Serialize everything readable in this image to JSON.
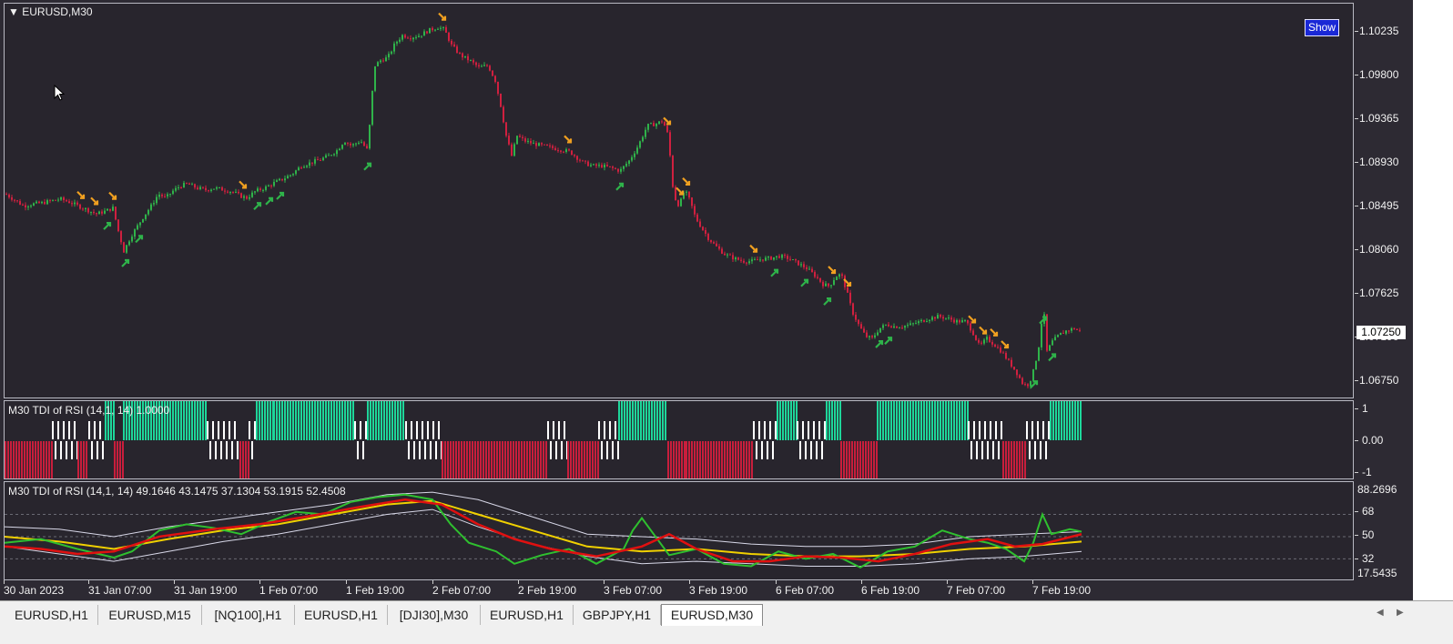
{
  "main_chart": {
    "symbol_label": "EURUSD,M30",
    "show_button": "Show",
    "price_scale": [
      "1.10235",
      "1.09800",
      "1.09365",
      "1.08930",
      "1.08495",
      "1.08060",
      "1.07625",
      "1.07190",
      "1.06750"
    ],
    "current_price": "1.07250"
  },
  "histogram_indicator": {
    "label": "M30  TDI of RSI  (14,1, 14) 1.0000",
    "scale": [
      "1",
      "0.00",
      "-1"
    ]
  },
  "tdi_indicator": {
    "label": "M30  TDI of RSI  (14,1, 14) 49.1646 43.1475 37.1304 53.1915 52.4508",
    "scale": [
      "88.2696",
      "68",
      "50",
      "32",
      "17.5435"
    ]
  },
  "time_axis": [
    "30 Jan 2023",
    "31 Jan 07:00",
    "31 Jan 19:00",
    "1 Feb 07:00",
    "1 Feb 19:00",
    "2 Feb 07:00",
    "2 Feb 19:00",
    "3 Feb 07:00",
    "3 Feb 19:00",
    "6 Feb 07:00",
    "6 Feb 19:00",
    "7 Feb 07:00",
    "7 Feb 19:00"
  ],
  "tabs": [
    "EURUSD,H1",
    "EURUSD,M15",
    "[NQ100],H1",
    "EURUSD,H1",
    "[DJI30],M30",
    "EURUSD,H1",
    "GBPJPY,H1",
    "EURUSD,M30"
  ],
  "active_tab": 7,
  "colors": {
    "background": "#28252d",
    "bull_candle": "#2fb34a",
    "bear_candle": "#d0203f",
    "buy_arrow": "#2fb34a",
    "sell_arrow": "#f0a020",
    "hist_up": "#1ed69a",
    "hist_down": "#c81e3c",
    "hist_neutral": "#ffffff",
    "rsi_line": "#2fc02f",
    "signal_line": "#e01010",
    "market_base": "#f0d000",
    "bands": "#d8d8e8"
  },
  "chart_data": {
    "type": "candlestick",
    "timeframe": "M30",
    "close_path": [
      [
        0,
        1.0862
      ],
      [
        10,
        1.0856
      ],
      [
        20,
        1.085
      ],
      [
        30,
        1.0852
      ],
      [
        40,
        1.0853
      ],
      [
        50,
        1.0855
      ],
      [
        60,
        1.0857
      ],
      [
        70,
        1.0854
      ],
      [
        80,
        1.085
      ],
      [
        90,
        1.0846
      ],
      [
        100,
        1.0842
      ],
      [
        110,
        1.0845
      ],
      [
        118,
        1.0848
      ],
      [
        124,
        1.0825
      ],
      [
        130,
        1.0805
      ],
      [
        138,
        1.082
      ],
      [
        145,
        1.083
      ],
      [
        152,
        1.084
      ],
      [
        160,
        1.085
      ],
      [
        168,
        1.0862
      ],
      [
        176,
        1.0858
      ],
      [
        184,
        1.0865
      ],
      [
        192,
        1.087
      ],
      [
        200,
        1.0872
      ],
      [
        210,
        1.0868
      ],
      [
        220,
        1.0866
      ],
      [
        230,
        1.0868
      ],
      [
        240,
        1.0866
      ],
      [
        250,
        1.0864
      ],
      [
        258,
        1.086
      ],
      [
        265,
        1.0858
      ],
      [
        275,
        1.0865
      ],
      [
        285,
        1.0868
      ],
      [
        295,
        1.0873
      ],
      [
        305,
        1.0877
      ],
      [
        315,
        1.0882
      ],
      [
        325,
        1.089
      ],
      [
        335,
        1.0893
      ],
      [
        345,
        1.0896
      ],
      [
        355,
        1.09
      ],
      [
        365,
        1.0906
      ],
      [
        372,
        1.0915
      ],
      [
        380,
        1.091
      ],
      [
        390,
        1.0915
      ],
      [
        398,
        1.0905
      ],
      [
        402,
        1.0955
      ],
      [
        406,
        1.099
      ],
      [
        412,
        1.0995
      ],
      [
        420,
        1.0998
      ],
      [
        428,
        1.1012
      ],
      [
        436,
        1.102
      ],
      [
        445,
        1.1018
      ],
      [
        455,
        1.102
      ],
      [
        465,
        1.1025
      ],
      [
        475,
        1.1028
      ],
      [
        482,
        1.1026
      ],
      [
        490,
        1.101
      ],
      [
        500,
        1.1
      ],
      [
        510,
        1.0995
      ],
      [
        520,
        1.0988
      ],
      [
        530,
        1.099
      ],
      [
        538,
        1.0975
      ],
      [
        544,
        1.095
      ],
      [
        550,
        1.092
      ],
      [
        556,
        1.09
      ],
      [
        562,
        1.092
      ],
      [
        570,
        1.0915
      ],
      [
        580,
        1.0912
      ],
      [
        590,
        1.091
      ],
      [
        600,
        1.0908
      ],
      [
        610,
        1.0906
      ],
      [
        620,
        1.0904
      ],
      [
        628,
        1.0898
      ],
      [
        635,
        1.0893
      ],
      [
        645,
        1.089
      ],
      [
        655,
        1.089
      ],
      [
        665,
        1.0888
      ],
      [
        675,
        1.0885
      ],
      [
        685,
        1.0895
      ],
      [
        695,
        1.091
      ],
      [
        705,
        1.093
      ],
      [
        715,
        1.0932
      ],
      [
        722,
        1.0935
      ],
      [
        728,
        1.092
      ],
      [
        734,
        1.086
      ],
      [
        740,
        1.085
      ],
      [
        746,
        1.0866
      ],
      [
        752,
        1.0855
      ],
      [
        758,
        1.0838
      ],
      [
        765,
        1.0828
      ],
      [
        772,
        1.0818
      ],
      [
        780,
        1.081
      ],
      [
        790,
        1.0802
      ],
      [
        800,
        1.0798
      ],
      [
        810,
        1.0795
      ],
      [
        820,
        1.0795
      ],
      [
        830,
        1.0797
      ],
      [
        840,
        1.0798
      ],
      [
        850,
        1.08
      ],
      [
        860,
        1.0798
      ],
      [
        870,
        1.0793
      ],
      [
        880,
        1.0788
      ],
      [
        890,
        1.078
      ],
      [
        898,
        1.0772
      ],
      [
        905,
        1.077
      ],
      [
        912,
        1.078
      ],
      [
        918,
        1.0782
      ],
      [
        924,
        1.0765
      ],
      [
        930,
        1.0745
      ],
      [
        938,
        1.073
      ],
      [
        945,
        1.072
      ],
      [
        952,
        1.0718
      ],
      [
        960,
        1.0728
      ],
      [
        968,
        1.0732
      ],
      [
        976,
        1.073
      ],
      [
        985,
        1.073
      ],
      [
        995,
        1.0732
      ],
      [
        1005,
        1.0735
      ],
      [
        1015,
        1.0738
      ],
      [
        1025,
        1.074
      ],
      [
        1035,
        1.0738
      ],
      [
        1045,
        1.0735
      ],
      [
        1055,
        1.0735
      ],
      [
        1062,
        1.0725
      ],
      [
        1070,
        1.071
      ],
      [
        1078,
        1.0718
      ],
      [
        1086,
        1.0712
      ],
      [
        1094,
        1.0705
      ],
      [
        1102,
        1.0695
      ],
      [
        1110,
        1.0685
      ],
      [
        1118,
        1.0672
      ],
      [
        1124,
        1.0672
      ],
      [
        1130,
        1.0688
      ],
      [
        1136,
        1.0715
      ],
      [
        1140,
        1.0752
      ],
      [
        1144,
        1.0705
      ],
      [
        1150,
        1.0715
      ],
      [
        1158,
        1.0722
      ],
      [
        1166,
        1.0726
      ],
      [
        1174,
        1.0728
      ],
      [
        1180,
        1.0725
      ]
    ],
    "sell_arrows_x": [
      83,
      98,
      118,
      261,
      480,
      618,
      727,
      741,
      748,
      822,
      908,
      925,
      1062,
      1074,
      1086,
      1098
    ],
    "buy_arrows_x": [
      112,
      132,
      147,
      277,
      290,
      302,
      398,
      675,
      845,
      878,
      903,
      960,
      970,
      1130,
      1140,
      1150
    ],
    "histogram_segments": [
      {
        "from": 0,
        "to": 52,
        "state": -1
      },
      {
        "from": 52,
        "to": 80,
        "state": 0
      },
      {
        "from": 80,
        "to": 92,
        "state": -1
      },
      {
        "from": 92,
        "to": 110,
        "state": 0
      },
      {
        "from": 110,
        "to": 120,
        "state": 1
      },
      {
        "from": 120,
        "to": 130,
        "state": -1
      },
      {
        "from": 130,
        "to": 222,
        "state": 1
      },
      {
        "from": 222,
        "to": 258,
        "state": 0
      },
      {
        "from": 258,
        "to": 268,
        "state": -1
      },
      {
        "from": 268,
        "to": 276,
        "state": 0
      },
      {
        "from": 276,
        "to": 295,
        "state": 1
      },
      {
        "from": 295,
        "to": 384,
        "state": 1
      },
      {
        "from": 384,
        "to": 398,
        "state": 0
      },
      {
        "from": 398,
        "to": 440,
        "state": 1
      },
      {
        "from": 440,
        "to": 480,
        "state": 0
      },
      {
        "from": 480,
        "to": 596,
        "state": -1
      },
      {
        "from": 596,
        "to": 618,
        "state": 0
      },
      {
        "from": 618,
        "to": 652,
        "state": -1
      },
      {
        "from": 652,
        "to": 674,
        "state": 0
      },
      {
        "from": 674,
        "to": 728,
        "state": 1
      },
      {
        "from": 728,
        "to": 748,
        "state": -1
      },
      {
        "from": 748,
        "to": 822,
        "state": -1
      },
      {
        "from": 822,
        "to": 848,
        "state": 0
      },
      {
        "from": 848,
        "to": 870,
        "state": 1
      },
      {
        "from": 870,
        "to": 902,
        "state": 0
      },
      {
        "from": 902,
        "to": 918,
        "state": 1
      },
      {
        "from": 918,
        "to": 958,
        "state": -1
      },
      {
        "from": 958,
        "to": 1058,
        "state": 1
      },
      {
        "from": 1058,
        "to": 1096,
        "state": 0
      },
      {
        "from": 1096,
        "to": 1122,
        "state": -1
      },
      {
        "from": 1122,
        "to": 1148,
        "state": 0
      },
      {
        "from": 1148,
        "to": 1183,
        "state": 1
      }
    ],
    "tdi": {
      "ylim": [
        17.5435,
        88.2696
      ],
      "rsi": [
        [
          0,
          45
        ],
        [
          40,
          48
        ],
        [
          80,
          40
        ],
        [
          120,
          33
        ],
        [
          140,
          38
        ],
        [
          170,
          55
        ],
        [
          200,
          60
        ],
        [
          230,
          57
        ],
        [
          260,
          52
        ],
        [
          290,
          62
        ],
        [
          320,
          70
        ],
        [
          350,
          68
        ],
        [
          380,
          78
        ],
        [
          410,
          82
        ],
        [
          440,
          84
        ],
        [
          470,
          80
        ],
        [
          490,
          60
        ],
        [
          510,
          45
        ],
        [
          540,
          38
        ],
        [
          560,
          28
        ],
        [
          590,
          35
        ],
        [
          620,
          40
        ],
        [
          650,
          28
        ],
        [
          680,
          40
        ],
        [
          690,
          55
        ],
        [
          700,
          65
        ],
        [
          715,
          50
        ],
        [
          730,
          35
        ],
        [
          760,
          40
        ],
        [
          790,
          28
        ],
        [
          820,
          26
        ],
        [
          850,
          38
        ],
        [
          880,
          32
        ],
        [
          910,
          36
        ],
        [
          940,
          25
        ],
        [
          970,
          38
        ],
        [
          1000,
          42
        ],
        [
          1030,
          55
        ],
        [
          1060,
          48
        ],
        [
          1080,
          45
        ],
        [
          1100,
          40
        ],
        [
          1120,
          30
        ],
        [
          1130,
          45
        ],
        [
          1140,
          68
        ],
        [
          1150,
          52
        ],
        [
          1170,
          56
        ],
        [
          1183,
          54
        ]
      ],
      "signal": [
        [
          0,
          42
        ],
        [
          40,
          40
        ],
        [
          80,
          36
        ],
        [
          120,
          38
        ],
        [
          170,
          50
        ],
        [
          230,
          56
        ],
        [
          280,
          60
        ],
        [
          330,
          66
        ],
        [
          390,
          74
        ],
        [
          440,
          80
        ],
        [
          480,
          76
        ],
        [
          520,
          60
        ],
        [
          560,
          48
        ],
        [
          600,
          40
        ],
        [
          650,
          34
        ],
        [
          700,
          42
        ],
        [
          730,
          52
        ],
        [
          760,
          40
        ],
        [
          800,
          30
        ],
        [
          840,
          30
        ],
        [
          880,
          34
        ],
        [
          920,
          33
        ],
        [
          960,
          30
        ],
        [
          1000,
          36
        ],
        [
          1040,
          44
        ],
        [
          1080,
          48
        ],
        [
          1110,
          42
        ],
        [
          1140,
          44
        ],
        [
          1183,
          52
        ]
      ],
      "base": [
        [
          0,
          50
        ],
        [
          60,
          46
        ],
        [
          120,
          40
        ],
        [
          180,
          48
        ],
        [
          240,
          55
        ],
        [
          300,
          60
        ],
        [
          360,
          68
        ],
        [
          420,
          76
        ],
        [
          470,
          79
        ],
        [
          520,
          68
        ],
        [
          580,
          55
        ],
        [
          640,
          42
        ],
        [
          700,
          38
        ],
        [
          760,
          40
        ],
        [
          820,
          36
        ],
        [
          880,
          34
        ],
        [
          940,
          34
        ],
        [
          1000,
          36
        ],
        [
          1060,
          40
        ],
        [
          1120,
          42
        ],
        [
          1183,
          46
        ]
      ],
      "upper_band": [
        [
          0,
          58
        ],
        [
          60,
          56
        ],
        [
          120,
          50
        ],
        [
          180,
          58
        ],
        [
          240,
          64
        ],
        [
          300,
          70
        ],
        [
          360,
          76
        ],
        [
          420,
          84
        ],
        [
          470,
          86
        ],
        [
          520,
          80
        ],
        [
          580,
          66
        ],
        [
          640,
          52
        ],
        [
          700,
          50
        ],
        [
          760,
          48
        ],
        [
          820,
          44
        ],
        [
          880,
          42
        ],
        [
          940,
          42
        ],
        [
          1000,
          44
        ],
        [
          1060,
          50
        ],
        [
          1120,
          52
        ],
        [
          1183,
          54
        ]
      ],
      "lower_band": [
        [
          0,
          42
        ],
        [
          60,
          36
        ],
        [
          120,
          30
        ],
        [
          180,
          38
        ],
        [
          240,
          46
        ],
        [
          300,
          52
        ],
        [
          360,
          60
        ],
        [
          420,
          68
        ],
        [
          470,
          72
        ],
        [
          520,
          58
        ],
        [
          580,
          44
        ],
        [
          640,
          34
        ],
        [
          700,
          28
        ],
        [
          760,
          30
        ],
        [
          820,
          28
        ],
        [
          880,
          26
        ],
        [
          940,
          26
        ],
        [
          1000,
          28
        ],
        [
          1060,
          32
        ],
        [
          1120,
          34
        ],
        [
          1183,
          38
        ]
      ]
    }
  }
}
